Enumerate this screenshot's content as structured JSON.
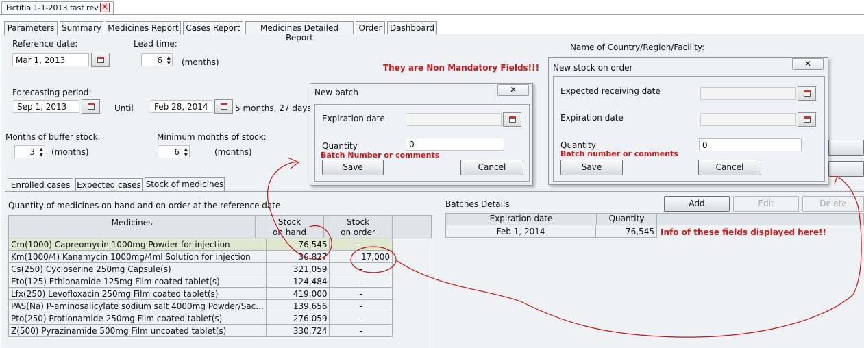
{
  "document_tab": {
    "title": "Fictitia 1-1-2013 fast rev"
  },
  "main_tabs": [
    "Parameters",
    "Summary",
    "Medicines Report",
    "Cases Report",
    "Medicines Detailed Report",
    "Order",
    "Dashboard"
  ],
  "params": {
    "reference_date_label": "Reference date:",
    "reference_date": "Mar 1, 2013",
    "lead_time_label": "Lead time:",
    "lead_time": "6",
    "lead_time_unit": "(months)",
    "forecasting_label": "Forecasting period:",
    "forecast_start": "Sep 1, 2013",
    "until_label": "Until",
    "forecast_end": "Feb 28, 2014",
    "period_duration": "5 months, 27 days",
    "buffer_label": "Months of buffer stock:",
    "buffer_value": "3",
    "buffer_unit": "(months)",
    "min_stock_label": "Minimum months of stock:",
    "min_stock_value": "6",
    "min_stock_unit": "(months)",
    "country_label": "Name of Country/Region/Facility:"
  },
  "notes": {
    "non_mandatory": "They are Non Mandatory Fields!!!",
    "info_displayed": "Info of these fields displayed here!!"
  },
  "new_batch_dialog": {
    "title": "New batch",
    "close": "✕",
    "expiration_label": "Expiration date",
    "expiration_value": "",
    "quantity_label": "Quantity",
    "quantity_value": "0",
    "batch_note": "Batch Number or comments",
    "save": "Save",
    "cancel": "Cancel"
  },
  "new_stock_dialog": {
    "title": "New stock on order",
    "close": "✕",
    "receiving_label": "Expected receiving date",
    "receiving_value": "",
    "expiration_label": "Expiration date",
    "expiration_value": "",
    "quantity_label": "Quantity",
    "quantity_value": "0",
    "batch_note": "Batch number or comments",
    "save": "Save",
    "cancel": "Cancel"
  },
  "sub_tabs": [
    "Enrolled cases",
    "Expected cases",
    "Stock of medicines"
  ],
  "medicines_section": {
    "title": "Quantity of medicines on hand and on order at the reference date",
    "col_medicines": "Medicines",
    "col_on_hand_1": "Stock",
    "col_on_hand_2": "on hand",
    "col_on_order_1": "Stock",
    "col_on_order_2": "on order",
    "rows": [
      {
        "name": "Cm(1000)  Capreomycin  1000mg  Powder for injection",
        "on_hand": "76,545",
        "on_order": "-"
      },
      {
        "name": "Km(1000/4)  Kanamycin  1000mg/4ml  Solution for injection",
        "on_hand": "36,827",
        "on_order": "17,000"
      },
      {
        "name": "Cs(250)  Cycloserine  250mg  Capsule(s)",
        "on_hand": "321,059",
        "on_order": "-"
      },
      {
        "name": "Eto(125)  Ethionamide  125mg  Film coated tablet(s)",
        "on_hand": "124,484",
        "on_order": "-"
      },
      {
        "name": "Lfx(250)  Levofloxacin  250mg  Film coated tablet(s)",
        "on_hand": "419,000",
        "on_order": "-"
      },
      {
        "name": "PAS(Na)  P-aminosalicylate sodium salt  4000mg  Powder/Sac...",
        "on_hand": "139,656",
        "on_order": "-"
      },
      {
        "name": "Pto(250)  Protionamide  250mg  Film coated tablet(s)",
        "on_hand": "276,059",
        "on_order": "-"
      },
      {
        "name": "Z(500)  Pyrazinamide  500mg  Film uncoated tablet(s)",
        "on_hand": "330,724",
        "on_order": "-"
      }
    ]
  },
  "batches": {
    "title": "Batches Details",
    "add": "Add",
    "edit": "Edit",
    "delete": "Delete",
    "col_expiration": "Expiration date",
    "col_quantity": "Quantity",
    "rows": [
      {
        "expiration": "Feb 1, 2014",
        "quantity": "76,545"
      }
    ]
  },
  "colors": {
    "annotation_red": "#d01818",
    "selected_row": "#dfe8cf",
    "panel": "#eef2f5"
  }
}
